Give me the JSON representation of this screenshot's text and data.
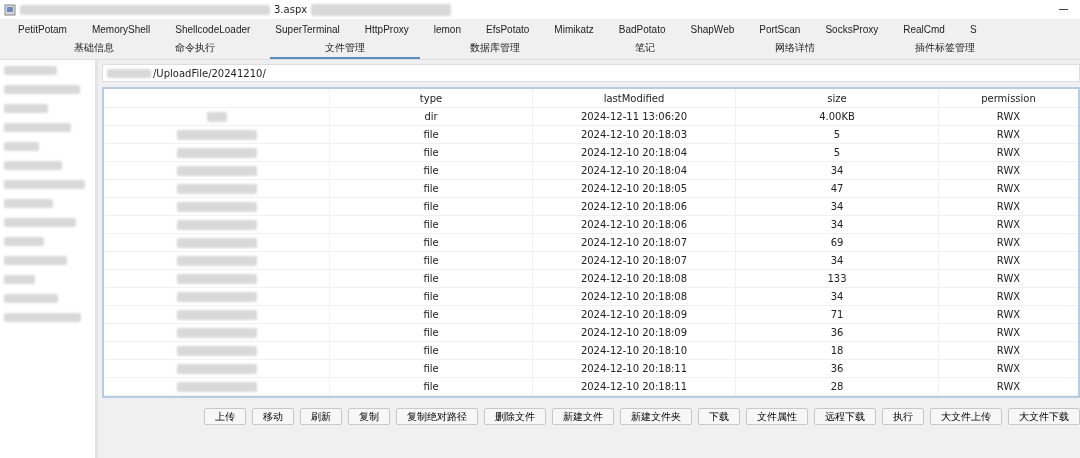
{
  "window": {
    "title": "3.aspx"
  },
  "plugin_tabs": [
    "PetitPotam",
    "MemoryShell",
    "ShellcodeLoader",
    "SuperTerminal",
    "HttpProxy",
    "lemon",
    "EfsPotato",
    "Mimikatz",
    "BadPotato",
    "ShapWeb",
    "PortScan",
    "SocksProxy",
    "RealCmd",
    "S"
  ],
  "tabs": [
    {
      "label": "基础信息",
      "selected": false
    },
    {
      "label": "命令执行",
      "selected": false
    },
    {
      "label": "文件管理",
      "selected": true
    },
    {
      "label": "数据库管理",
      "selected": false
    },
    {
      "label": "笔记",
      "selected": false
    },
    {
      "label": "网络详情",
      "selected": false
    },
    {
      "label": "插件标签管理",
      "selected": false
    }
  ],
  "path": {
    "value": "/UploadFile/20241210/"
  },
  "table": {
    "columns": [
      "type",
      "lastModified",
      "size",
      "permission"
    ],
    "rows": [
      {
        "type": "dir",
        "lastModified": "2024-12-11 13:06:20",
        "size": "4.00KB",
        "permission": "RWX"
      },
      {
        "type": "file",
        "lastModified": "2024-12-10 20:18:03",
        "size": "5",
        "permission": "RWX"
      },
      {
        "type": "file",
        "lastModified": "2024-12-10 20:18:04",
        "size": "5",
        "permission": "RWX"
      },
      {
        "type": "file",
        "lastModified": "2024-12-10 20:18:04",
        "size": "34",
        "permission": "RWX"
      },
      {
        "type": "file",
        "lastModified": "2024-12-10 20:18:05",
        "size": "47",
        "permission": "RWX"
      },
      {
        "type": "file",
        "lastModified": "2024-12-10 20:18:06",
        "size": "34",
        "permission": "RWX"
      },
      {
        "type": "file",
        "lastModified": "2024-12-10 20:18:06",
        "size": "34",
        "permission": "RWX"
      },
      {
        "type": "file",
        "lastModified": "2024-12-10 20:18:07",
        "size": "69",
        "permission": "RWX"
      },
      {
        "type": "file",
        "lastModified": "2024-12-10 20:18:07",
        "size": "34",
        "permission": "RWX"
      },
      {
        "type": "file",
        "lastModified": "2024-12-10 20:18:08",
        "size": "133",
        "permission": "RWX"
      },
      {
        "type": "file",
        "lastModified": "2024-12-10 20:18:08",
        "size": "34",
        "permission": "RWX"
      },
      {
        "type": "file",
        "lastModified": "2024-12-10 20:18:09",
        "size": "71",
        "permission": "RWX"
      },
      {
        "type": "file",
        "lastModified": "2024-12-10 20:18:09",
        "size": "36",
        "permission": "RWX"
      },
      {
        "type": "file",
        "lastModified": "2024-12-10 20:18:10",
        "size": "18",
        "permission": "RWX"
      },
      {
        "type": "file",
        "lastModified": "2024-12-10 20:18:11",
        "size": "36",
        "permission": "RWX"
      },
      {
        "type": "file",
        "lastModified": "2024-12-10 20:18:11",
        "size": "28",
        "permission": "RWX"
      }
    ]
  },
  "buttons": [
    "上传",
    "移动",
    "刷新",
    "复制",
    "复制绝对路径",
    "删除文件",
    "新建文件",
    "新建文件夹",
    "下载",
    "文件属性",
    "远程下载",
    "执行",
    "大文件上传",
    "大文件下载"
  ]
}
